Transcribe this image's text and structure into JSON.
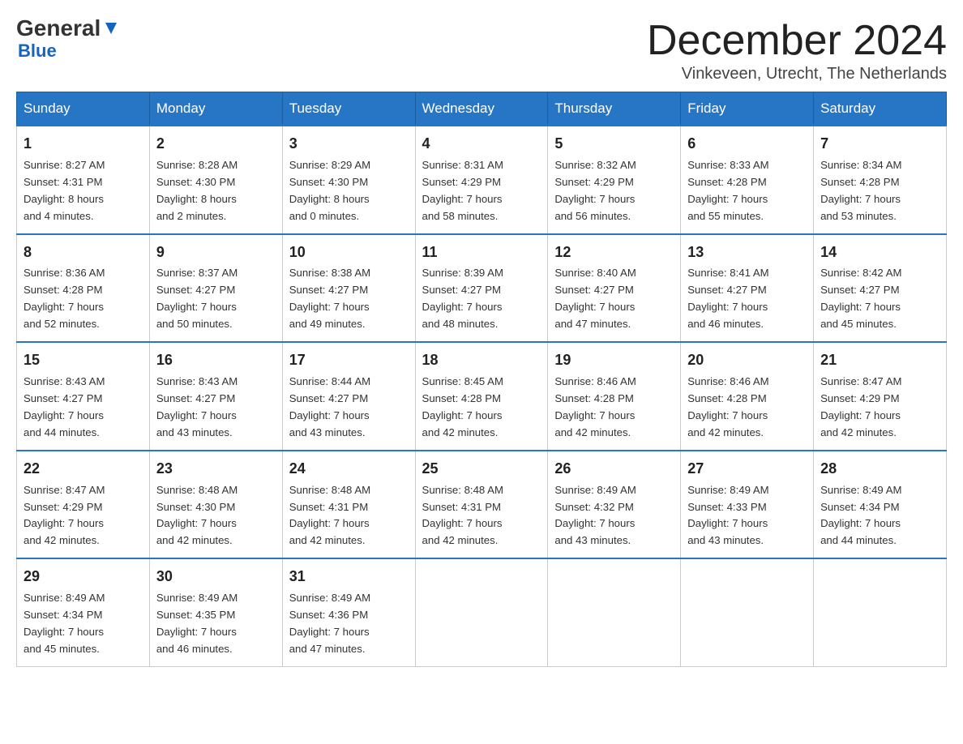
{
  "logo": {
    "general": "General",
    "blue": "Blue"
  },
  "title": "December 2024",
  "location": "Vinkeveen, Utrecht, The Netherlands",
  "weekdays": [
    "Sunday",
    "Monday",
    "Tuesday",
    "Wednesday",
    "Thursday",
    "Friday",
    "Saturday"
  ],
  "weeks": [
    [
      {
        "day": "1",
        "info": "Sunrise: 8:27 AM\nSunset: 4:31 PM\nDaylight: 8 hours\nand 4 minutes."
      },
      {
        "day": "2",
        "info": "Sunrise: 8:28 AM\nSunset: 4:30 PM\nDaylight: 8 hours\nand 2 minutes."
      },
      {
        "day": "3",
        "info": "Sunrise: 8:29 AM\nSunset: 4:30 PM\nDaylight: 8 hours\nand 0 minutes."
      },
      {
        "day": "4",
        "info": "Sunrise: 8:31 AM\nSunset: 4:29 PM\nDaylight: 7 hours\nand 58 minutes."
      },
      {
        "day": "5",
        "info": "Sunrise: 8:32 AM\nSunset: 4:29 PM\nDaylight: 7 hours\nand 56 minutes."
      },
      {
        "day": "6",
        "info": "Sunrise: 8:33 AM\nSunset: 4:28 PM\nDaylight: 7 hours\nand 55 minutes."
      },
      {
        "day": "7",
        "info": "Sunrise: 8:34 AM\nSunset: 4:28 PM\nDaylight: 7 hours\nand 53 minutes."
      }
    ],
    [
      {
        "day": "8",
        "info": "Sunrise: 8:36 AM\nSunset: 4:28 PM\nDaylight: 7 hours\nand 52 minutes."
      },
      {
        "day": "9",
        "info": "Sunrise: 8:37 AM\nSunset: 4:27 PM\nDaylight: 7 hours\nand 50 minutes."
      },
      {
        "day": "10",
        "info": "Sunrise: 8:38 AM\nSunset: 4:27 PM\nDaylight: 7 hours\nand 49 minutes."
      },
      {
        "day": "11",
        "info": "Sunrise: 8:39 AM\nSunset: 4:27 PM\nDaylight: 7 hours\nand 48 minutes."
      },
      {
        "day": "12",
        "info": "Sunrise: 8:40 AM\nSunset: 4:27 PM\nDaylight: 7 hours\nand 47 minutes."
      },
      {
        "day": "13",
        "info": "Sunrise: 8:41 AM\nSunset: 4:27 PM\nDaylight: 7 hours\nand 46 minutes."
      },
      {
        "day": "14",
        "info": "Sunrise: 8:42 AM\nSunset: 4:27 PM\nDaylight: 7 hours\nand 45 minutes."
      }
    ],
    [
      {
        "day": "15",
        "info": "Sunrise: 8:43 AM\nSunset: 4:27 PM\nDaylight: 7 hours\nand 44 minutes."
      },
      {
        "day": "16",
        "info": "Sunrise: 8:43 AM\nSunset: 4:27 PM\nDaylight: 7 hours\nand 43 minutes."
      },
      {
        "day": "17",
        "info": "Sunrise: 8:44 AM\nSunset: 4:27 PM\nDaylight: 7 hours\nand 43 minutes."
      },
      {
        "day": "18",
        "info": "Sunrise: 8:45 AM\nSunset: 4:28 PM\nDaylight: 7 hours\nand 42 minutes."
      },
      {
        "day": "19",
        "info": "Sunrise: 8:46 AM\nSunset: 4:28 PM\nDaylight: 7 hours\nand 42 minutes."
      },
      {
        "day": "20",
        "info": "Sunrise: 8:46 AM\nSunset: 4:28 PM\nDaylight: 7 hours\nand 42 minutes."
      },
      {
        "day": "21",
        "info": "Sunrise: 8:47 AM\nSunset: 4:29 PM\nDaylight: 7 hours\nand 42 minutes."
      }
    ],
    [
      {
        "day": "22",
        "info": "Sunrise: 8:47 AM\nSunset: 4:29 PM\nDaylight: 7 hours\nand 42 minutes."
      },
      {
        "day": "23",
        "info": "Sunrise: 8:48 AM\nSunset: 4:30 PM\nDaylight: 7 hours\nand 42 minutes."
      },
      {
        "day": "24",
        "info": "Sunrise: 8:48 AM\nSunset: 4:31 PM\nDaylight: 7 hours\nand 42 minutes."
      },
      {
        "day": "25",
        "info": "Sunrise: 8:48 AM\nSunset: 4:31 PM\nDaylight: 7 hours\nand 42 minutes."
      },
      {
        "day": "26",
        "info": "Sunrise: 8:49 AM\nSunset: 4:32 PM\nDaylight: 7 hours\nand 43 minutes."
      },
      {
        "day": "27",
        "info": "Sunrise: 8:49 AM\nSunset: 4:33 PM\nDaylight: 7 hours\nand 43 minutes."
      },
      {
        "day": "28",
        "info": "Sunrise: 8:49 AM\nSunset: 4:34 PM\nDaylight: 7 hours\nand 44 minutes."
      }
    ],
    [
      {
        "day": "29",
        "info": "Sunrise: 8:49 AM\nSunset: 4:34 PM\nDaylight: 7 hours\nand 45 minutes."
      },
      {
        "day": "30",
        "info": "Sunrise: 8:49 AM\nSunset: 4:35 PM\nDaylight: 7 hours\nand 46 minutes."
      },
      {
        "day": "31",
        "info": "Sunrise: 8:49 AM\nSunset: 4:36 PM\nDaylight: 7 hours\nand 47 minutes."
      },
      null,
      null,
      null,
      null
    ]
  ]
}
